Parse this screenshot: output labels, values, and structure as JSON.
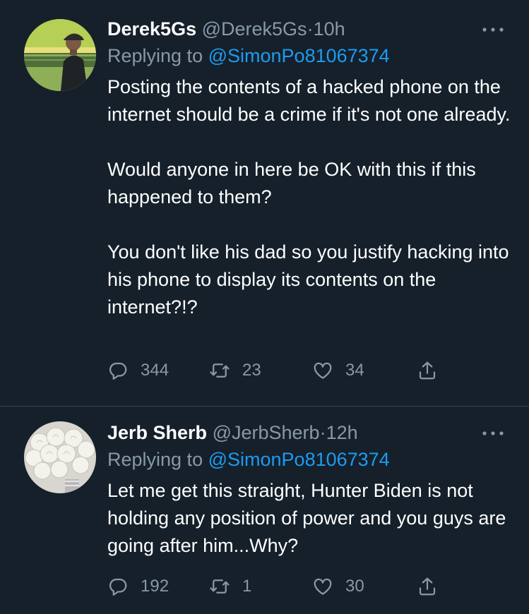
{
  "colors": {
    "background": "#15202b",
    "text_primary": "#ffffff",
    "text_secondary": "#8899a6",
    "mention": "#1d9bf0",
    "divider": "#38444d"
  },
  "tweets": [
    {
      "display_name": "Derek5Gs",
      "handle": "@Derek5Gs",
      "separator": "·",
      "time": "10h",
      "replying_prefix": "Replying to",
      "replying_to": "@SimonPo81067374",
      "paragraphs": [
        "Posting the contents of a hacked phone on the internet should be a crime if it's not one already.",
        "Would anyone in here be OK with this if this happened to them?",
        "You don't like his dad so you justify hacking into his phone to display its contents on the internet?!?"
      ],
      "reply_count": "344",
      "retweet_count": "23",
      "like_count": "34",
      "avatar_icon": "man-with-cap-by-lake-photo",
      "more_icon": "more-horizontal-icon"
    },
    {
      "display_name": "Jerb Sherb",
      "handle": "@JerbSherb",
      "separator": "·",
      "time": "12h",
      "replying_prefix": "Replying to",
      "replying_to": "@SimonPo81067374",
      "paragraphs": [
        "Let me get this straight, Hunter Biden is not holding any position of power and you guys are going after him...Why?"
      ],
      "reply_count": "192",
      "retweet_count": "1",
      "like_count": "30",
      "avatar_icon": "white-roses-bouquet-photo",
      "more_icon": "more-horizontal-icon"
    }
  ]
}
